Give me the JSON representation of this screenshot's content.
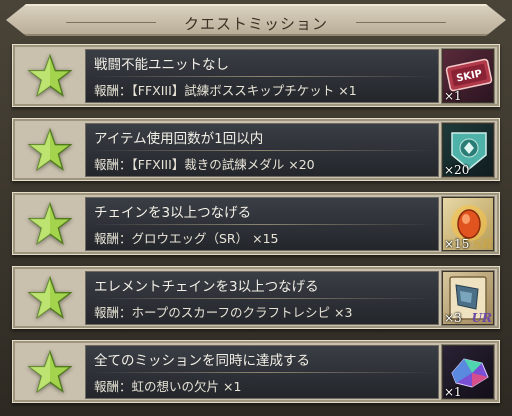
{
  "header": {
    "title": "クエストミッション"
  },
  "missions": [
    {
      "title": "戦闘不能ユニットなし",
      "reward": "報酬：【FFXIII】試練ボススキップチケット ×1",
      "qty": "×1",
      "rarity": "",
      "icon": "skip-ticket-icon"
    },
    {
      "title": "アイテム使用回数が1回以内",
      "reward": "報酬：【FFXIII】裁きの試練メダル ×20",
      "qty": "×20",
      "rarity": "",
      "icon": "trial-medal-icon"
    },
    {
      "title": "チェインを3以上つなげる",
      "reward": "報酬：グロウエッグ（SR） ×15",
      "qty": "×15",
      "rarity": "SR",
      "icon": "grow-egg-icon"
    },
    {
      "title": "エレメントチェインを3以上つなげる",
      "reward": "報酬：ホープのスカーフのクラフトレシピ ×3",
      "qty": "×3",
      "rarity": "UR",
      "icon": "craft-recipe-icon"
    },
    {
      "title": "全てのミッションを同時に達成する",
      "reward": "報酬：虹の想いの欠片 ×1",
      "qty": "×1",
      "rarity": "",
      "icon": "rainbow-shard-icon"
    }
  ],
  "colors": {
    "star": "#9fd24a",
    "panel": "#c9c1ad",
    "text_panel": "#2c2f35"
  }
}
